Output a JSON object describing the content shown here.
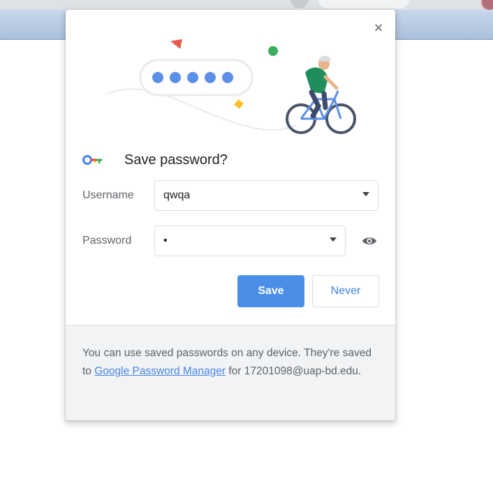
{
  "dialog": {
    "title": "Save password?",
    "username": {
      "label": "Username",
      "value": "qwqa"
    },
    "password": {
      "label": "Password",
      "value": "•"
    },
    "save_label": "Save",
    "never_label": "Never",
    "close_glyph": "×",
    "footer": {
      "text_before": "You can use saved passwords on any device. They're saved to ",
      "link_text": "Google Password Manager",
      "text_after": " for 17201098@uap-bd.edu."
    }
  },
  "colors": {
    "primary_blue": "#4b8ee8",
    "link_blue": "#4a86e8",
    "text_dark": "#202124",
    "text_muted": "#5f6368",
    "footer_bg": "#f1f3f4"
  },
  "icons": {
    "close": "close-icon",
    "key": "key-icon",
    "dropdown": "chevron-down-icon",
    "reveal_password": "eye-icon",
    "illustration": "cyclist-illustration"
  }
}
